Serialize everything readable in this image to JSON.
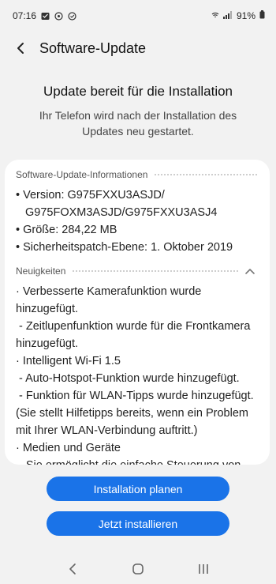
{
  "status_bar": {
    "time": "07:16",
    "battery": "91%"
  },
  "header": {
    "title": "Software-Update"
  },
  "hero": {
    "title": "Update bereit für die Installation",
    "subtitle": "Ihr Telefon wird nach der Installation des Updates neu gestartet."
  },
  "info": {
    "heading": "Software-Update-Informationen",
    "version_line1": "• Version: G975FXXU3ASJD/",
    "version_line2": "G975FOXM3ASJD/G975FXXU3ASJ4",
    "size": "• Größe: 284,22 MB",
    "patch": "• Sicherheitspatch-Ebene: 1. Oktober 2019"
  },
  "news": {
    "heading": "Neuigkeiten",
    "lines": [
      "· Verbesserte Kamerafunktion wurde",
      "hinzugefügt.",
      " - Zeitlupenfunktion wurde für die Frontkamera",
      "hinzugefügt.",
      "· Intelligent Wi-Fi 1.5",
      " - Auto-Hotspot-Funktion wurde hinzugefügt.",
      " - Funktion für WLAN-Tipps wurde hinzugefügt.",
      "(Sie stellt Hilfetipps bereits, wenn ein Problem",
      "mit Ihrer WLAN-Verbindung auftritt.)",
      "· Medien und Geräte",
      " - Sie ermöglicht die einfache Steuerung von"
    ]
  },
  "buttons": {
    "schedule": "Installation planen",
    "install_now": "Jetzt installieren"
  },
  "colors": {
    "accent": "#1a73e8",
    "background": "#f2f2f2",
    "card": "#ffffff"
  }
}
